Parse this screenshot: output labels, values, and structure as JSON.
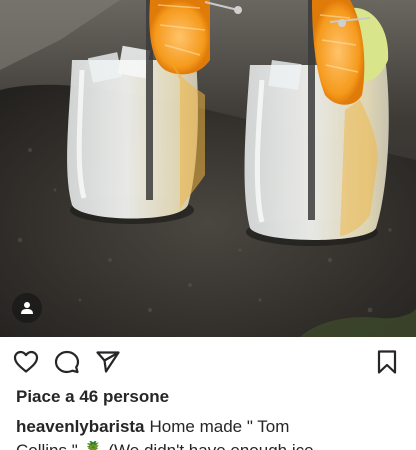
{
  "post": {
    "image_alt": "Two glasses of Tom Collins with orange slices and straws on a stone ledge",
    "user_tag_icon": "person-icon"
  },
  "actions": {
    "like_icon": "heart-outline-icon",
    "comment_icon": "speech-bubble-icon",
    "share_icon": "paper-plane-icon",
    "save_icon": "bookmark-outline-icon"
  },
  "likes": {
    "text": "Piace a 46 persone"
  },
  "caption": {
    "username": "heavenlybarista",
    "text_line1": "Home made \" Tom",
    "text_line2": "Collins \" 🍍 (We didn't have enough ice"
  }
}
